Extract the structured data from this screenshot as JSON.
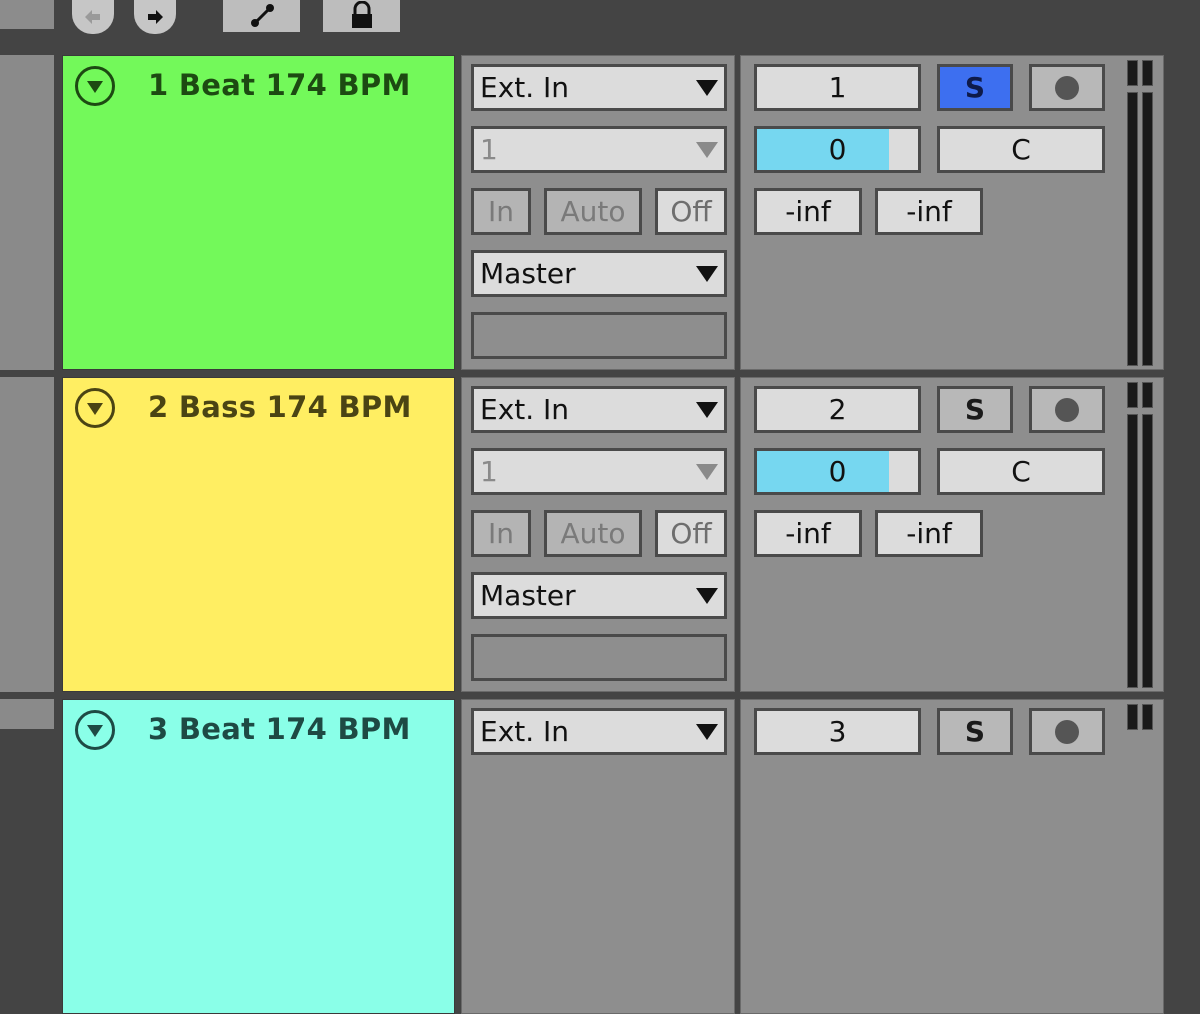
{
  "toolbar": {
    "back_icon": "arrow-left-circle-icon",
    "forward_icon": "arrow-right-circle-icon",
    "automation_icon": "automation-curve-icon",
    "lock_icon": "lock-icon"
  },
  "colors": {
    "solo_active": "#3d6ff0",
    "volume_fill": "#76d7f0"
  },
  "tracks": [
    {
      "name": "1 Beat 174 BPM",
      "color": "#73f95a",
      "fold_color": "#1d4a12",
      "input_type": "Ext. In",
      "input_channel": "1",
      "monitor": [
        "In",
        "Auto",
        "Off"
      ],
      "monitor_selected": "Off",
      "output": "Master",
      "track_number": "1",
      "solo_label": "S",
      "solo_active": true,
      "volume": "0",
      "volume_fill_fraction": 0.82,
      "pan": "C",
      "send_a": "-inf",
      "send_b": "-inf"
    },
    {
      "name": "2 Bass 174 BPM",
      "color": "#ffee62",
      "fold_color": "#4a4414",
      "input_type": "Ext. In",
      "input_channel": "1",
      "monitor": [
        "In",
        "Auto",
        "Off"
      ],
      "monitor_selected": "Off",
      "output": "Master",
      "track_number": "2",
      "solo_label": "S",
      "solo_active": false,
      "volume": "0",
      "volume_fill_fraction": 0.82,
      "pan": "C",
      "send_a": "-inf",
      "send_b": "-inf"
    },
    {
      "name": "3 Beat 174 BPM",
      "color": "#8affe8",
      "fold_color": "#1e4a44",
      "input_type": "Ext. In",
      "track_number": "3",
      "solo_label": "S"
    }
  ]
}
